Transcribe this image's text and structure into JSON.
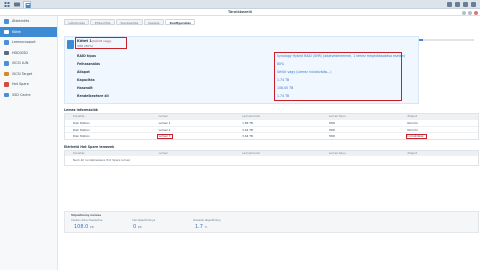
{
  "window": {
    "title": "Tárolókezelő"
  },
  "taskbar": {
    "buttons": [
      "grid",
      "drive",
      "app"
    ]
  },
  "sidebar": {
    "items": [
      {
        "label": "Áttekintés",
        "icon": "overview-icon",
        "color": "#4a90d9"
      },
      {
        "label": "Kötet",
        "icon": "volume-icon",
        "color": "#ffffff",
        "active": true
      },
      {
        "label": "Lemezcsoport",
        "icon": "diskgroup-icon",
        "color": "#4a90d9"
      },
      {
        "label": "HDD/SSD",
        "icon": "hdd-icon",
        "color": "#5b6b7c"
      },
      {
        "label": "iSCSI LUN",
        "icon": "lun-icon",
        "color": "#4a90d9"
      },
      {
        "label": "iSCSI Target",
        "icon": "target-icon",
        "color": "#d88a2b"
      },
      {
        "label": "Hot Spare",
        "icon": "hotspare-icon",
        "color": "#d94a3d"
      },
      {
        "label": "SSD Cache",
        "icon": "cache-icon",
        "color": "#4a90d9"
      }
    ]
  },
  "tabs": [
    "Létrehozás",
    "Eltávolítás",
    "Szerkesztés",
    "Kezelés",
    "Konfigurálás"
  ],
  "volume": {
    "name": "Kötet 1",
    "status_inline": "(Sérült vagy)",
    "sub": "SHR (80%)",
    "capacity_text": "108.00 TB / 1.74 TB",
    "usage_fraction": 0.08
  },
  "properties": [
    {
      "label": "RAID típus",
      "value": "Synology Hybrid RAID (SHR) (adatvédelemmel, 1 lemez meghibásodása esetén)"
    },
    {
      "label": "Felhasználás",
      "value": "80%"
    },
    {
      "label": "Állapot",
      "value": "Sérült vagy (Lemez inicializálás...)"
    },
    {
      "label": "Kapacitás",
      "value": "1.74 TB"
    },
    {
      "label": "Használt",
      "value": "108.00 TB"
    },
    {
      "label": "Rendelkezésre áll",
      "value": "1.74 TB"
    }
  ],
  "disk_section": {
    "title": "Lemez információk",
    "headers": [
      "Kiosztás",
      "Lemez",
      "Lemezméret",
      "Lemez típus",
      "Állapot"
    ],
    "rows": [
      [
        "Disk Station",
        "Lemez 1",
        "1.86 TB",
        "HDD",
        "Normál"
      ],
      [
        "Disk Station",
        "Lemez 2",
        "3.64 TB",
        "HDD",
        "Normál"
      ],
      [
        "Disk Station",
        "Lemez 3",
        "3.64 TB",
        "HDD",
        "Inicializálás"
      ]
    ]
  },
  "hotspare_section": {
    "title": "Elérhető Hot Spare lemezek",
    "headers": [
      "Kiosztás",
      "Lemez",
      "Lemezméret",
      "Lemez típus",
      "Állapot"
    ],
    "empty": "Nem áll rendelkezésre Hot Spare lemez"
  },
  "stats": {
    "title": "Teljesítmény mérése",
    "items": [
      {
        "label": "Írásban állva Összesítve",
        "value": "108.0",
        "unit": "kB"
      },
      {
        "label": "Írás teljesítménye",
        "value": "0",
        "unit": "kB"
      },
      {
        "label": "Olvasási teljesítmény",
        "value": "1.7",
        "unit": "%"
      }
    ]
  }
}
